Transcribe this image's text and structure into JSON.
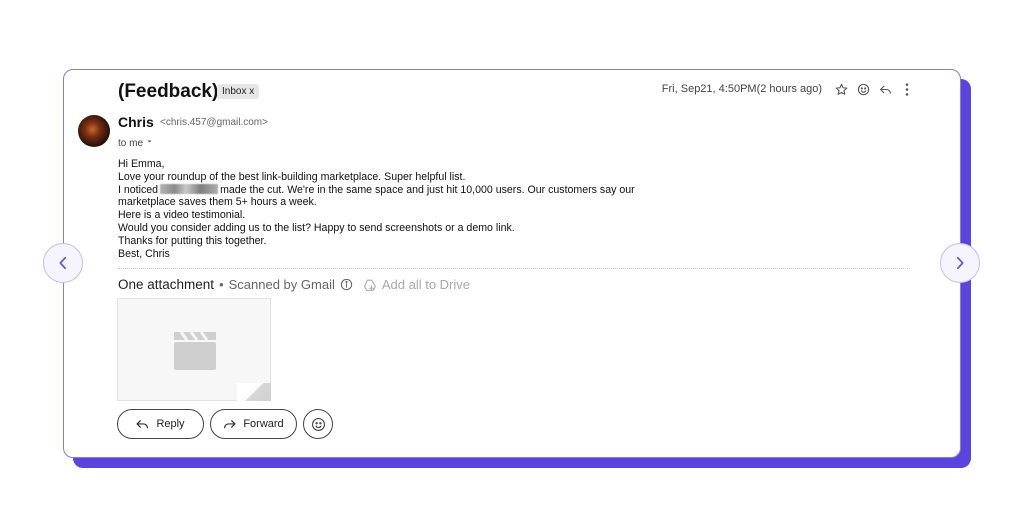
{
  "email": {
    "subject": "(Feedback)",
    "label": "Inbox x",
    "timestamp": "Fri, Sep21, 4:50PM(2 hours ago)",
    "sender_name": "Chris",
    "sender_email": "<chris.457@gmail.com>",
    "recipient": "to me",
    "body": {
      "greeting": "Hi Emma,",
      "line1": "Love your roundup of the best link-building marketplace. Super helpful list.",
      "line2_prefix": "I noticed",
      "line2_suffix": "made the cut. We're in the same space and just hit 10,000 users. Our customers say our",
      "line3": "marketplace saves them 5+ hours a week.",
      "line4": "Here is a video testimonial.",
      "line5": "Would you consider adding us to the list? Happy to send screenshots or a demo link.",
      "line6": "Thanks for putting this together.",
      "signoff": "Best, Chris"
    },
    "attachments": {
      "title": "One attachment",
      "separator": "•",
      "scanned": "Scanned by Gmail",
      "add_all": "Add all to Drive"
    },
    "actions": {
      "reply": "Reply",
      "forward": "Forward"
    }
  },
  "icons": {
    "star": "star-icon",
    "emoji": "smiley-icon",
    "reply": "reply-icon",
    "more": "more-vert-icon",
    "info": "info-icon",
    "drive": "add-to-drive-icon",
    "video": "video-clapper-icon",
    "prev": "chevron-left-icon",
    "next": "chevron-right-icon"
  },
  "colors": {
    "accent": "#5b43e0",
    "card_border": "#8d7ad9",
    "nav_button": "#f6f4fd"
  }
}
